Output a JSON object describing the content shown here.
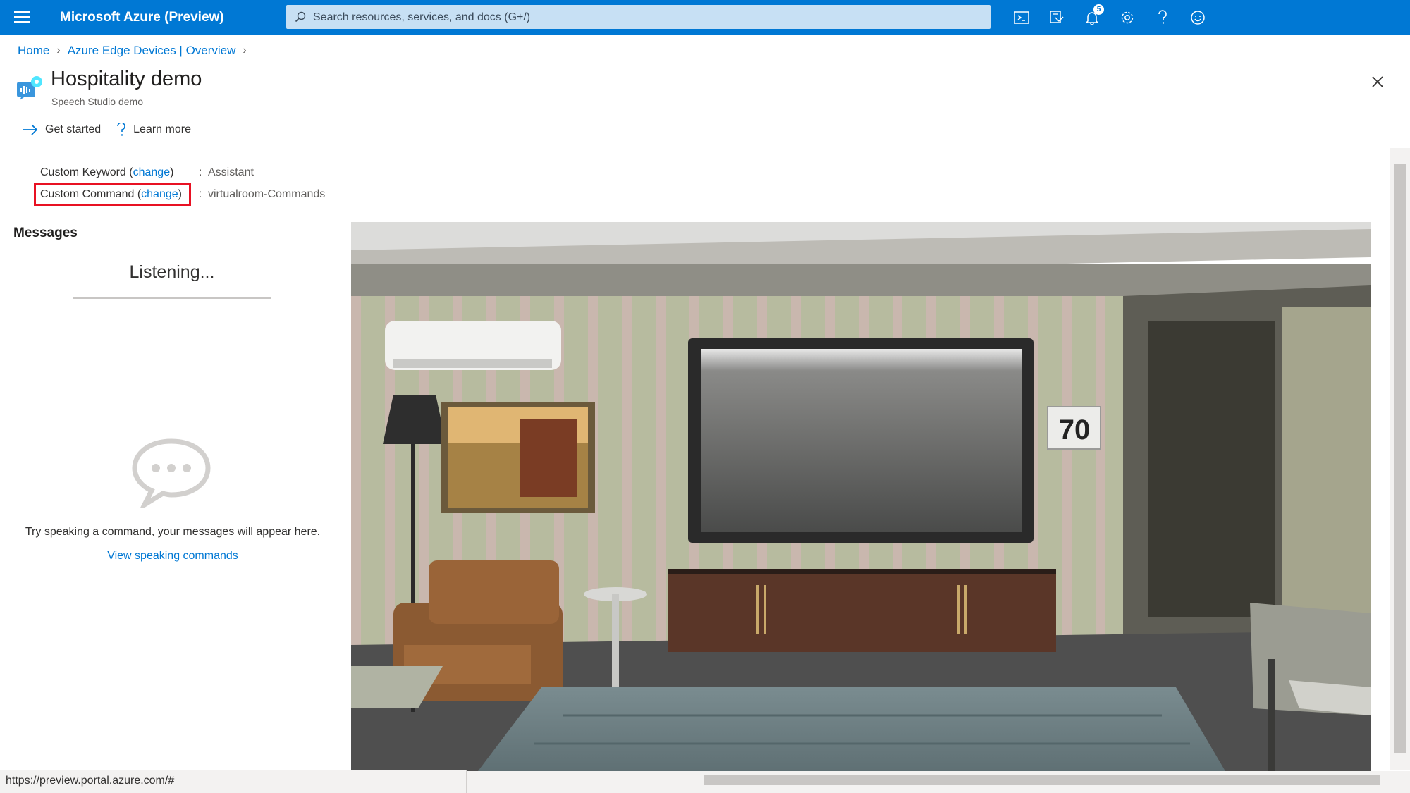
{
  "topbar": {
    "brand": "Microsoft Azure (Preview)",
    "search_placeholder": "Search resources, services, and docs (G+/)",
    "notification_count": "5",
    "icons": [
      "cloud-shell-icon",
      "directory-filter-icon",
      "notifications-icon",
      "settings-icon",
      "help-icon",
      "feedback-icon"
    ]
  },
  "breadcrumb": {
    "items": [
      "Home",
      "Azure Edge Devices | Overview"
    ]
  },
  "header": {
    "title": "Hospitality demo",
    "subtitle": "Speech Studio demo"
  },
  "commands": {
    "get_started": "Get started",
    "learn_more": "Learn more"
  },
  "settings": {
    "keyword": {
      "label": "Custom Keyword (",
      "link": "change",
      "close": ")",
      "colon": ":",
      "value": "Assistant"
    },
    "command": {
      "label": "Custom Command (",
      "link": "change",
      "close": ")",
      "colon": ":",
      "value": "virtualroom-Commands"
    }
  },
  "messages": {
    "heading": "Messages",
    "status": "Listening...",
    "hint": "Try speaking a command, your messages will appear here.",
    "link": "View speaking commands"
  },
  "scene": {
    "thermostat": "70"
  },
  "statusbar": {
    "url": "https://preview.portal.azure.com/#"
  },
  "colors": {
    "accent": "#0078d4",
    "highlight": "#e81123"
  }
}
